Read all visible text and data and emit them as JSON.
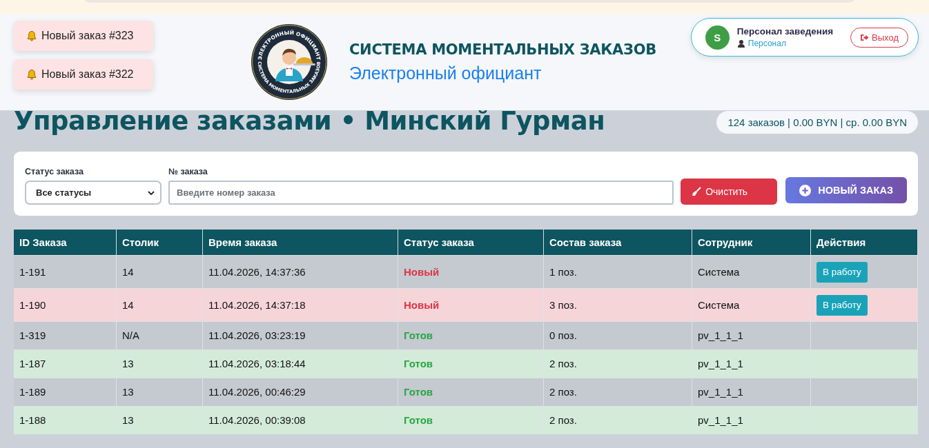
{
  "notifications": [
    {
      "text": "Новый заказ #323"
    },
    {
      "text": "Новый заказ #322"
    }
  ],
  "brand": {
    "logo_top_text": "ЭЛЕКТРОННЫЙ ОФИЦИАНТ",
    "logo_bottom_text": "СИСТЕМА МОМЕНТАЛЬНЫХ ЗАКАЗОВ",
    "title": "СИСТЕМА МОМЕНТАЛЬНЫХ ЗАКАЗОВ",
    "subtitle": "Электронный официант"
  },
  "user": {
    "avatar": "S",
    "name": "Персонал заведения",
    "role": "Персонал",
    "logout": "Выход"
  },
  "page": {
    "title": "Управление заказами • Минский Гурман",
    "summary": "124 заказов | 0.00 BYN | ср. 0.00 BYN"
  },
  "filters": {
    "status_label": "Статус заказа",
    "status_value": "Все статусы",
    "number_label": "№ заказа",
    "number_placeholder": "Введите номер заказа",
    "clear_button": "Очистить",
    "new_order_button": "НОВЫЙ ЗАКАЗ"
  },
  "table": {
    "columns": [
      "ID Заказа",
      "Столик",
      "Время заказа",
      "Статус заказа",
      "Состав заказа",
      "Сотрудник",
      "Действия"
    ],
    "rows": [
      {
        "id": "1-191",
        "table": "14",
        "time": "11.04.2026, 14:37:36",
        "status": "Новый",
        "kind": "new",
        "items": "1 поз.",
        "staff": "Система",
        "action": "В работу"
      },
      {
        "id": "1-190",
        "table": "14",
        "time": "11.04.2026, 14:37:18",
        "status": "Новый",
        "kind": "new",
        "items": "3 поз.",
        "staff": "Система",
        "action": "В работу"
      },
      {
        "id": "1-319",
        "table": "N/A",
        "time": "11.04.2026, 03:23:19",
        "status": "Готов",
        "kind": "ready",
        "items": "0 поз.",
        "staff": "pv_1_1_1"
      },
      {
        "id": "1-187",
        "table": "13",
        "time": "11.04.2026, 03:18:44",
        "status": "Готов",
        "kind": "ready",
        "items": "2 поз.",
        "staff": "pv_1_1_1"
      },
      {
        "id": "1-189",
        "table": "13",
        "time": "11.04.2026, 00:46:29",
        "status": "Готов",
        "kind": "ready",
        "items": "2 поз.",
        "staff": "pv_1_1_1"
      },
      {
        "id": "1-188",
        "table": "13",
        "time": "11.04.2026, 00:39:08",
        "status": "Готов",
        "kind": "ready",
        "items": "2 поз.",
        "staff": "pv_1_1_1"
      }
    ]
  }
}
